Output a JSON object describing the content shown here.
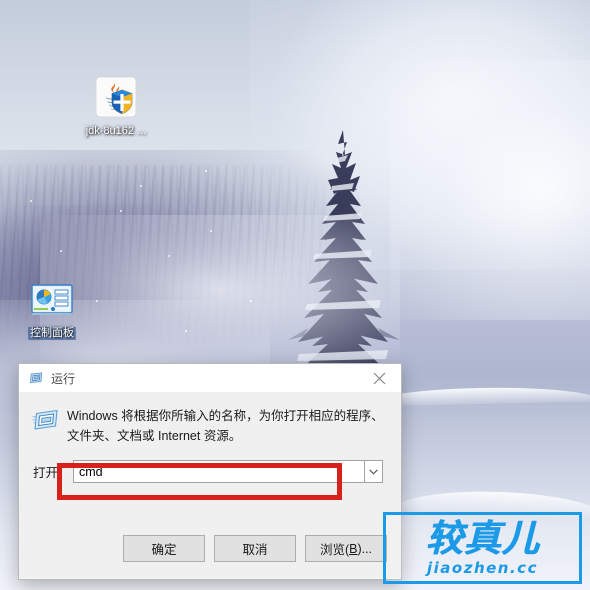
{
  "desktop": {
    "wallpaper_description": "snow-covered spruce tree with misty winter forest",
    "icons": [
      {
        "id": "jdk",
        "label": "jdk-8u162 ...",
        "icon": "java-jdk-icon"
      },
      {
        "id": "control-panel",
        "label": "控制面板",
        "icon": "control-panel-icon"
      }
    ]
  },
  "run_dialog": {
    "title": "运行",
    "title_icon": "run-window-icon",
    "close_label": "✕",
    "description_icon": "run-large-icon",
    "description": "Windows 将根据你所输入的名称，为你打开相应的程序、文件夹、文档或 Internet 资源。",
    "open_label": "打开",
    "input_value": "cmd",
    "input_placeholder": "",
    "dropdown_icon": "chevron-down-icon",
    "highlight_color": "#d8211b",
    "buttons": [
      {
        "id": "ok",
        "label": "确定"
      },
      {
        "id": "cancel",
        "label": "取消"
      },
      {
        "id": "browse",
        "label_prefix": "浏览(",
        "label_accel": "B",
        "label_suffix": ")..."
      }
    ]
  },
  "watermark": {
    "chinese": "较真儿",
    "domain": "jiaozhen.cc",
    "color": "#1b9ae8"
  }
}
